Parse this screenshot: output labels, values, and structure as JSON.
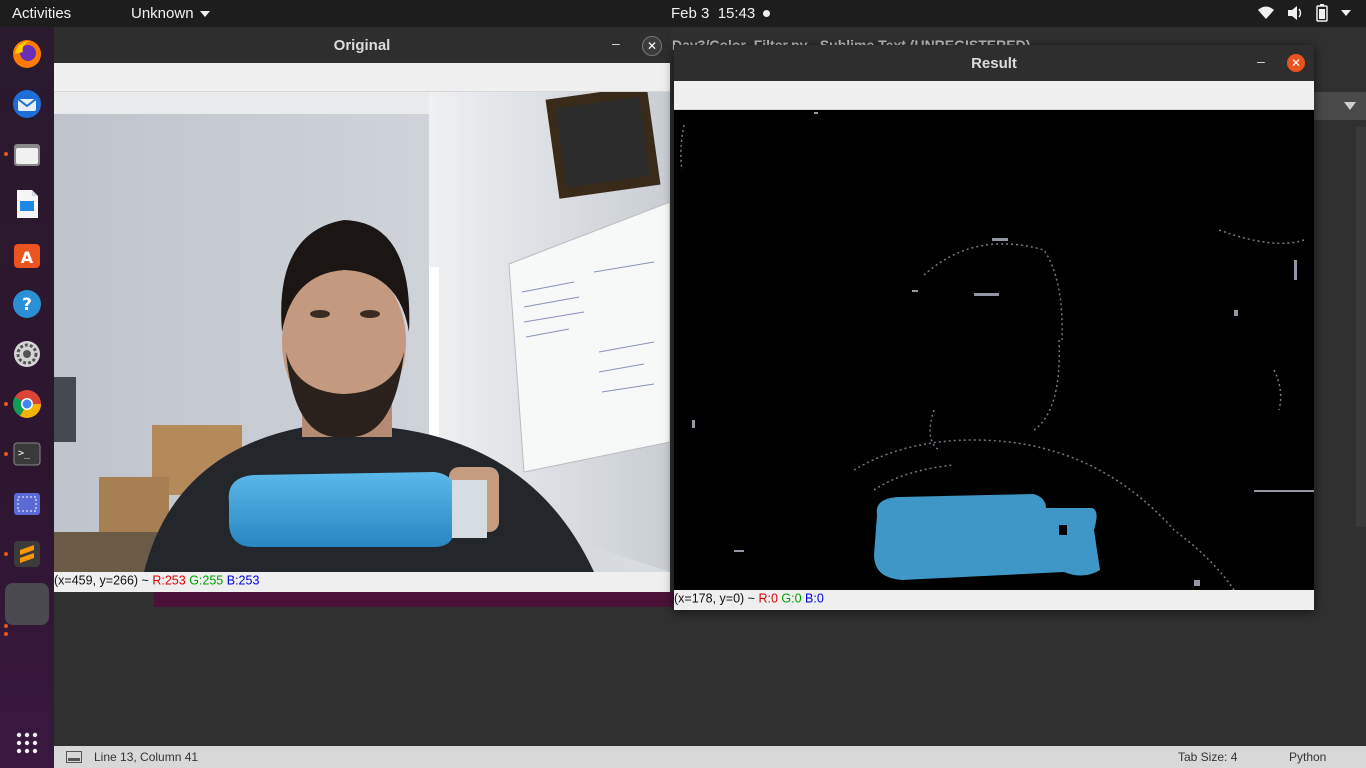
{
  "topbar": {
    "activities": "Activities",
    "app_menu": "Unknown",
    "date": "Feb 3",
    "time": "15:43",
    "icons": [
      "wifi-icon",
      "volume-icon",
      "battery-icon",
      "power-menu-icon"
    ]
  },
  "dock": {
    "items": [
      "firefox-icon",
      "thunderbird-icon",
      "files-icon",
      "writer-icon",
      "software-icon",
      "help-icon",
      "settings-icon",
      "chrome-icon",
      "terminal-icon",
      "screenshot-icon",
      "sublime-icon",
      "app-window-icon"
    ],
    "show_apps": "show-applications-icon"
  },
  "sublime": {
    "title": "Day3/Color_Filter.py - Sublime Text (UNREGISTERED)",
    "status_position": "Line 13, Column 41",
    "tab_size": "Tab Size: 4",
    "syntax": "Python"
  },
  "original_window": {
    "title": "Original",
    "min": "–",
    "close": "✕",
    "status_coords": "(x=459, y=266) ~",
    "status_r": "R:253",
    "status_g": "G:255",
    "status_b": "B:253"
  },
  "result_window": {
    "title": "Result",
    "min": "–",
    "close": "✕",
    "status_coords": "(x=178, y=0) ~",
    "status_r": "R:0",
    "status_g": "G:0",
    "status_b": "B:0"
  },
  "colors": {
    "accent": "#e95420",
    "topbar": "#1d1d1d",
    "bottle": "#3aa0d8"
  }
}
